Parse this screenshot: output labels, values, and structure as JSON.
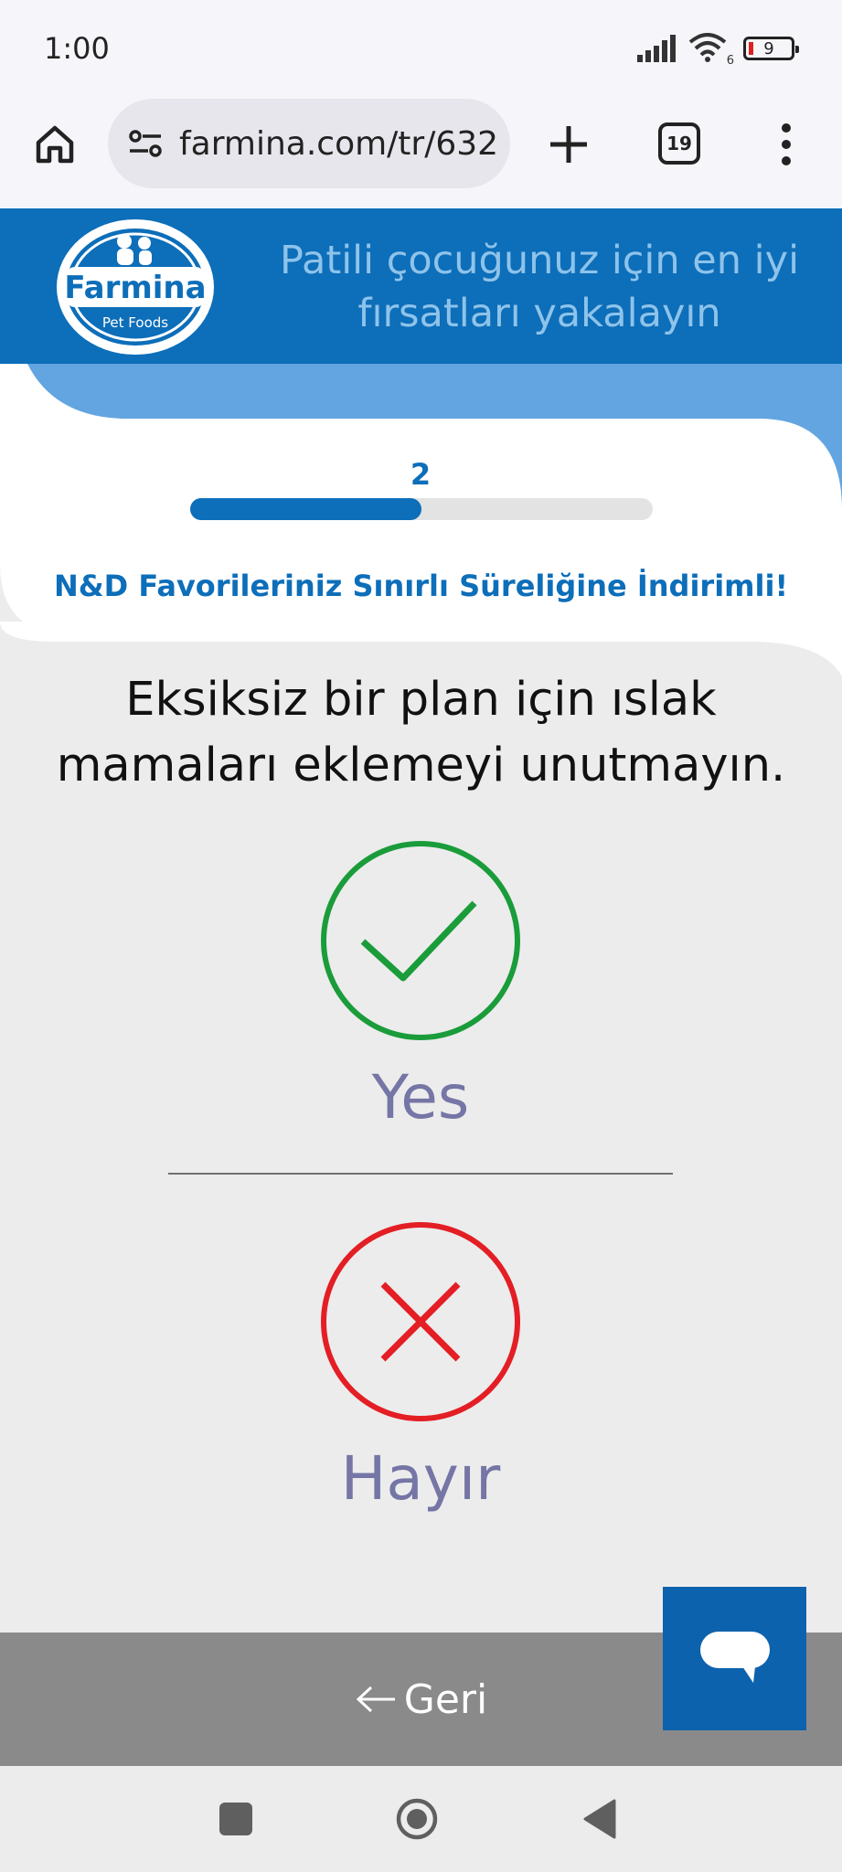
{
  "status_bar": {
    "time": "1:00",
    "battery_level": "9",
    "wifi_badge": "6"
  },
  "browser": {
    "url": "farmina.com/tr/632",
    "tab_count": "19"
  },
  "header": {
    "logo_brand": "Farmina",
    "logo_sub": "Pet Foods",
    "tagline": "Patili çocuğunuz için en iyi fırsatları yakalayın"
  },
  "progress": {
    "step": "2",
    "fraction": 0.5
  },
  "promo": "N&D Favorileriniz Sınırlı Süreliğine İndirimli!",
  "question": "Eksiksiz bir plan için ıslak mamaları eklemeyi unutmayın.",
  "options": {
    "yes": {
      "label": "Yes",
      "color": "#1a9c3a"
    },
    "no": {
      "label": "Hayır",
      "color": "#e31e24"
    }
  },
  "footer": {
    "back_label": "Geri"
  },
  "colors": {
    "brand": "#0d6eb9",
    "header_light": "#63a5e0",
    "option_text": "#7575a6"
  }
}
